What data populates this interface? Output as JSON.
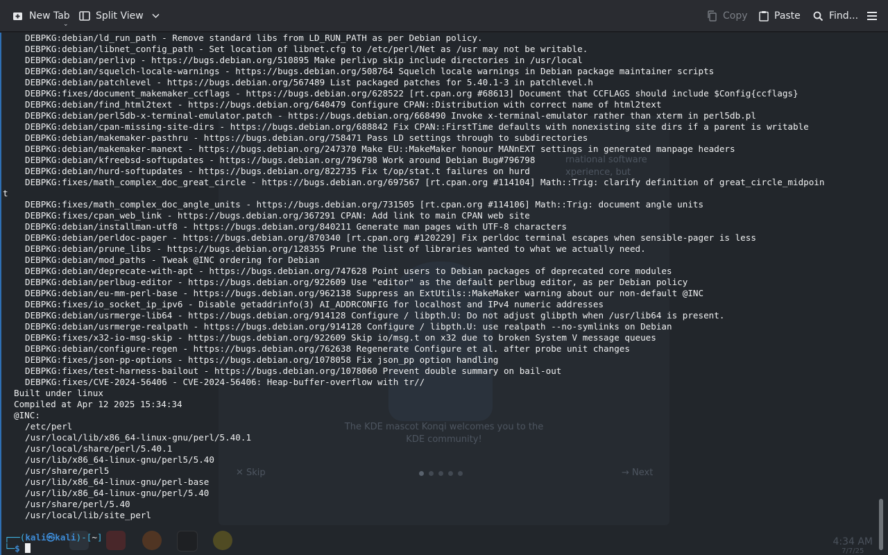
{
  "toolbar": {
    "new_tab": "New Tab",
    "split_view": "Split View",
    "copy": "Copy",
    "paste": "Paste",
    "find": "Find..."
  },
  "icons": {
    "new_tab": "new-tab-icon",
    "split_view": "split-view-icon",
    "copy": "copy-icon",
    "paste": "paste-icon",
    "find": "search-icon",
    "menu": "hamburger-menu-icon"
  },
  "output_lines": [
    {
      "indent": 2,
      "text": "DEBPKG:debian/ld_run_path - Remove standard libs from LD_RUN_PATH as per Debian policy."
    },
    {
      "indent": 2,
      "text": "DEBPKG:debian/libnet_config_path - Set location of libnet.cfg to /etc/perl/Net as /usr may not be writable."
    },
    {
      "indent": 2,
      "text": "DEBPKG:debian/perlivp - https://bugs.debian.org/510895 Make perlivp skip include directories in /usr/local"
    },
    {
      "indent": 2,
      "text": "DEBPKG:debian/squelch-locale-warnings - https://bugs.debian.org/508764 Squelch locale warnings in Debian package maintainer scripts"
    },
    {
      "indent": 2,
      "text": "DEBPKG:debian/patchlevel - https://bugs.debian.org/567489 List packaged patches for 5.40.1-3 in patchlevel.h"
    },
    {
      "indent": 2,
      "text": "DEBPKG:fixes/document_makemaker_ccflags - https://bugs.debian.org/628522 [rt.cpan.org #68613] Document that CCFLAGS should include $Config{ccflags}"
    },
    {
      "indent": 2,
      "text": "DEBPKG:debian/find_html2text - https://bugs.debian.org/640479 Configure CPAN::Distribution with correct name of html2text"
    },
    {
      "indent": 2,
      "text": "DEBPKG:debian/perl5db-x-terminal-emulator.patch - https://bugs.debian.org/668490 Invoke x-terminal-emulator rather than xterm in perl5db.pl"
    },
    {
      "indent": 2,
      "text": "DEBPKG:debian/cpan-missing-site-dirs - https://bugs.debian.org/688842 Fix CPAN::FirstTime defaults with nonexisting site dirs if a parent is writable"
    },
    {
      "indent": 2,
      "text": "DEBPKG:debian/makemaker-pasthru - https://bugs.debian.org/758471 Pass LD settings through to subdirectories"
    },
    {
      "indent": 2,
      "text": "DEBPKG:debian/makemaker-manext - https://bugs.debian.org/247370 Make EU::MakeMaker honour MANnEXT settings in generated manpage headers"
    },
    {
      "indent": 2,
      "text": "DEBPKG:debian/kfreebsd-softupdates - https://bugs.debian.org/796798 Work around Debian Bug#796798"
    },
    {
      "indent": 2,
      "text": "DEBPKG:debian/hurd-softupdates - https://bugs.debian.org/822735 Fix t/op/stat.t failures on hurd"
    },
    {
      "indent": 2,
      "text": "DEBPKG:fixes/math_complex_doc_great_circle - https://bugs.debian.org/697567 [rt.cpan.org #114104] Math::Trig: clarify definition of great_circle_midpoin"
    },
    {
      "indent": 0,
      "text": "t"
    },
    {
      "indent": 2,
      "text": "DEBPKG:fixes/math_complex_doc_angle_units - https://bugs.debian.org/731505 [rt.cpan.org #114106] Math::Trig: document angle units"
    },
    {
      "indent": 2,
      "text": "DEBPKG:fixes/cpan_web_link - https://bugs.debian.org/367291 CPAN: Add link to main CPAN web site"
    },
    {
      "indent": 2,
      "text": "DEBPKG:debian/installman-utf8 - https://bugs.debian.org/840211 Generate man pages with UTF-8 characters"
    },
    {
      "indent": 2,
      "text": "DEBPKG:debian/perldoc-pager - https://bugs.debian.org/870340 [rt.cpan.org #120229] Fix perldoc terminal escapes when sensible-pager is less"
    },
    {
      "indent": 2,
      "text": "DEBPKG:debian/prune_libs - https://bugs.debian.org/128355 Prune the list of libraries wanted to what we actually need."
    },
    {
      "indent": 2,
      "text": "DEBPKG:debian/mod_paths - Tweak @INC ordering for Debian"
    },
    {
      "indent": 2,
      "text": "DEBPKG:debian/deprecate-with-apt - https://bugs.debian.org/747628 Point users to Debian packages of deprecated core modules"
    },
    {
      "indent": 2,
      "text": "DEBPKG:debian/perlbug-editor - https://bugs.debian.org/922609 Use \"editor\" as the default perlbug editor, as per Debian policy"
    },
    {
      "indent": 2,
      "text": "DEBPKG:debian/eu-mm-perl-base - https://bugs.debian.org/962138 Suppress an ExtUtils::MakeMaker warning about our non-default @INC"
    },
    {
      "indent": 2,
      "text": "DEBPKG:fixes/io_socket_ip_ipv6 - Disable getaddrinfo(3) AI_ADDRCONFIG for localhost and IPv4 numeric addresses"
    },
    {
      "indent": 2,
      "text": "DEBPKG:debian/usrmerge-lib64 - https://bugs.debian.org/914128 Configure / libpth.U: Do not adjust glibpth when /usr/lib64 is present."
    },
    {
      "indent": 2,
      "text": "DEBPKG:debian/usrmerge-realpath - https://bugs.debian.org/914128 Configure / libpth.U: use realpath --no-symlinks on Debian"
    },
    {
      "indent": 2,
      "text": "DEBPKG:fixes/x32-io-msg-skip - https://bugs.debian.org/922609 Skip io/msg.t on x32 due to broken System V message queues"
    },
    {
      "indent": 2,
      "text": "DEBPKG:debian/configure-regen - https://bugs.debian.org/762638 Regenerate Configure et al. after probe unit changes"
    },
    {
      "indent": 2,
      "text": "DEBPKG:fixes/json-pp-options - https://bugs.debian.org/1078058 Fix json_pp option handling"
    },
    {
      "indent": 2,
      "text": "DEBPKG:fixes/test-harness-bailout - https://bugs.debian.org/1078060 Prevent double summary on bail-out"
    },
    {
      "indent": 2,
      "text": "DEBPKG:fixes/CVE-2024-56406 - CVE-2024-56406: Heap-buffer-overflow with tr//"
    },
    {
      "indent": 1,
      "text": "Built under linux"
    },
    {
      "indent": 1,
      "text": "Compiled at Apr 12 2025 15:34:34"
    },
    {
      "indent": 1,
      "text": "@INC:"
    },
    {
      "indent": 2,
      "text": "/etc/perl"
    },
    {
      "indent": 2,
      "text": "/usr/local/lib/x86_64-linux-gnu/perl/5.40.1"
    },
    {
      "indent": 2,
      "text": "/usr/local/share/perl/5.40.1"
    },
    {
      "indent": 2,
      "text": "/usr/lib/x86_64-linux-gnu/perl5/5.40"
    },
    {
      "indent": 2,
      "text": "/usr/share/perl5"
    },
    {
      "indent": 2,
      "text": "/usr/lib/x86_64-linux-gnu/perl-base"
    },
    {
      "indent": 2,
      "text": "/usr/lib/x86_64-linux-gnu/perl/5.40"
    },
    {
      "indent": 2,
      "text": "/usr/share/perl/5.40"
    },
    {
      "indent": 2,
      "text": "/usr/local/lib/site_perl"
    }
  ],
  "prompt": {
    "corner_top": "┌──(",
    "user": "kali",
    "at": "㉿",
    "host": "kali",
    "mid": ")-[",
    "cwd": "~",
    "end": "]",
    "corner_bottom": "└─",
    "symbol": "$"
  },
  "background_ghost": {
    "welcome": "The KDE mascot Konqi welcomes you to the KDE community!",
    "skip": "✕ Skip",
    "next": "→ Next",
    "fragment1": "rnational software",
    "fragment2": "xperience, but",
    "clock_time": "4:34 AM",
    "clock_date": "7/7/25"
  },
  "colors": {
    "terminal_bg": "#22262b",
    "prompt_user": "#3d8bd6",
    "prompt_frame": "#3fb7e8",
    "text": "#f0f1f2"
  }
}
